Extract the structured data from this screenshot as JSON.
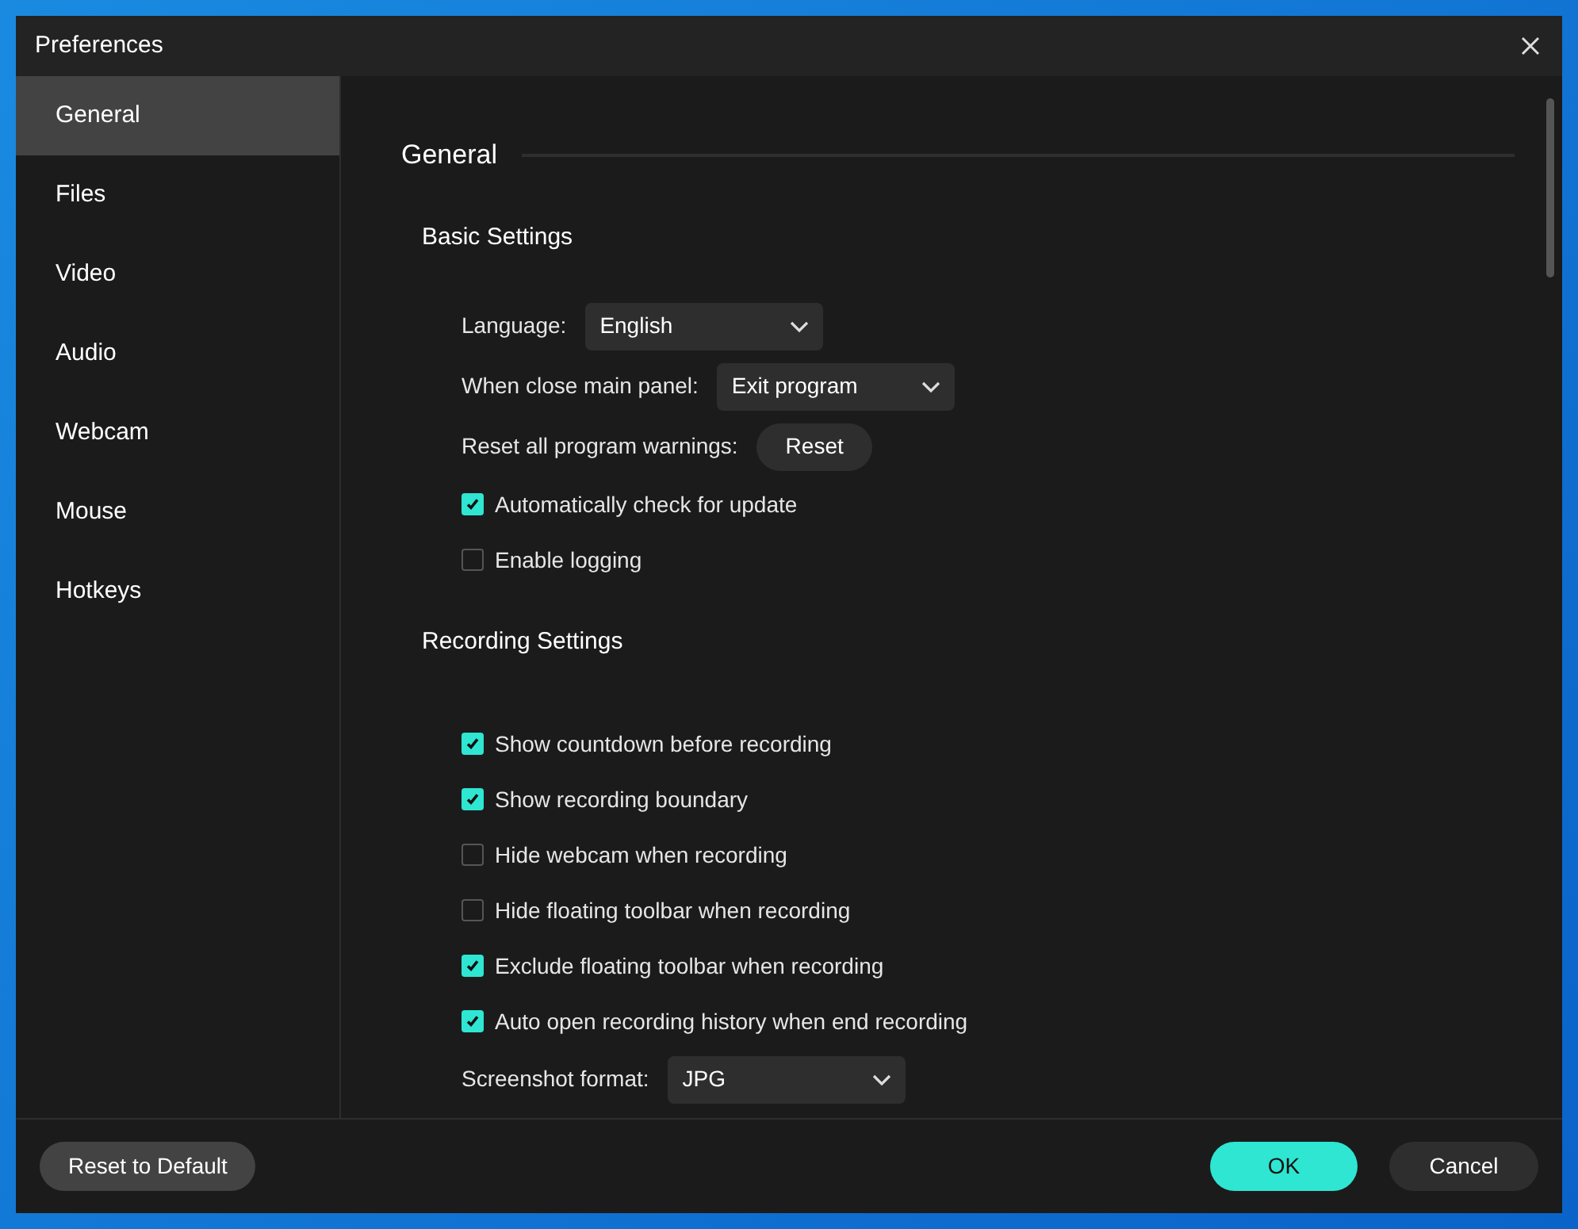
{
  "window": {
    "title": "Preferences"
  },
  "sidebar": {
    "items": [
      {
        "label": "General",
        "selected": true
      },
      {
        "label": "Files",
        "selected": false
      },
      {
        "label": "Video",
        "selected": false
      },
      {
        "label": "Audio",
        "selected": false
      },
      {
        "label": "Webcam",
        "selected": false
      },
      {
        "label": "Mouse",
        "selected": false
      },
      {
        "label": "Hotkeys",
        "selected": false
      }
    ]
  },
  "content": {
    "heading": "General",
    "sections": [
      {
        "title": "Basic Settings",
        "items": [
          {
            "kind": "select",
            "label": "Language:",
            "value": "English"
          },
          {
            "kind": "select",
            "label": "When close main panel:",
            "value": "Exit program"
          },
          {
            "kind": "button",
            "label": "Reset all program warnings:",
            "button": "Reset"
          },
          {
            "kind": "checkbox",
            "label": "Automatically check for update",
            "checked": true
          },
          {
            "kind": "checkbox",
            "label": "Enable logging",
            "checked": false
          }
        ]
      },
      {
        "title": "Recording Settings",
        "items": [
          {
            "kind": "checkbox",
            "label": "Show countdown before recording",
            "checked": true
          },
          {
            "kind": "checkbox",
            "label": "Show recording boundary",
            "checked": true
          },
          {
            "kind": "checkbox",
            "label": "Hide webcam when recording",
            "checked": false
          },
          {
            "kind": "checkbox",
            "label": "Hide floating toolbar when recording",
            "checked": false
          },
          {
            "kind": "checkbox",
            "label": "Exclude floating toolbar when recording",
            "checked": true
          },
          {
            "kind": "checkbox",
            "label": "Auto open recording history when end recording",
            "checked": true
          },
          {
            "kind": "select",
            "label": "Screenshot format:",
            "value": "JPG"
          }
        ]
      }
    ]
  },
  "footer": {
    "reset": "Reset to Default",
    "ok": "OK",
    "cancel": "Cancel"
  }
}
